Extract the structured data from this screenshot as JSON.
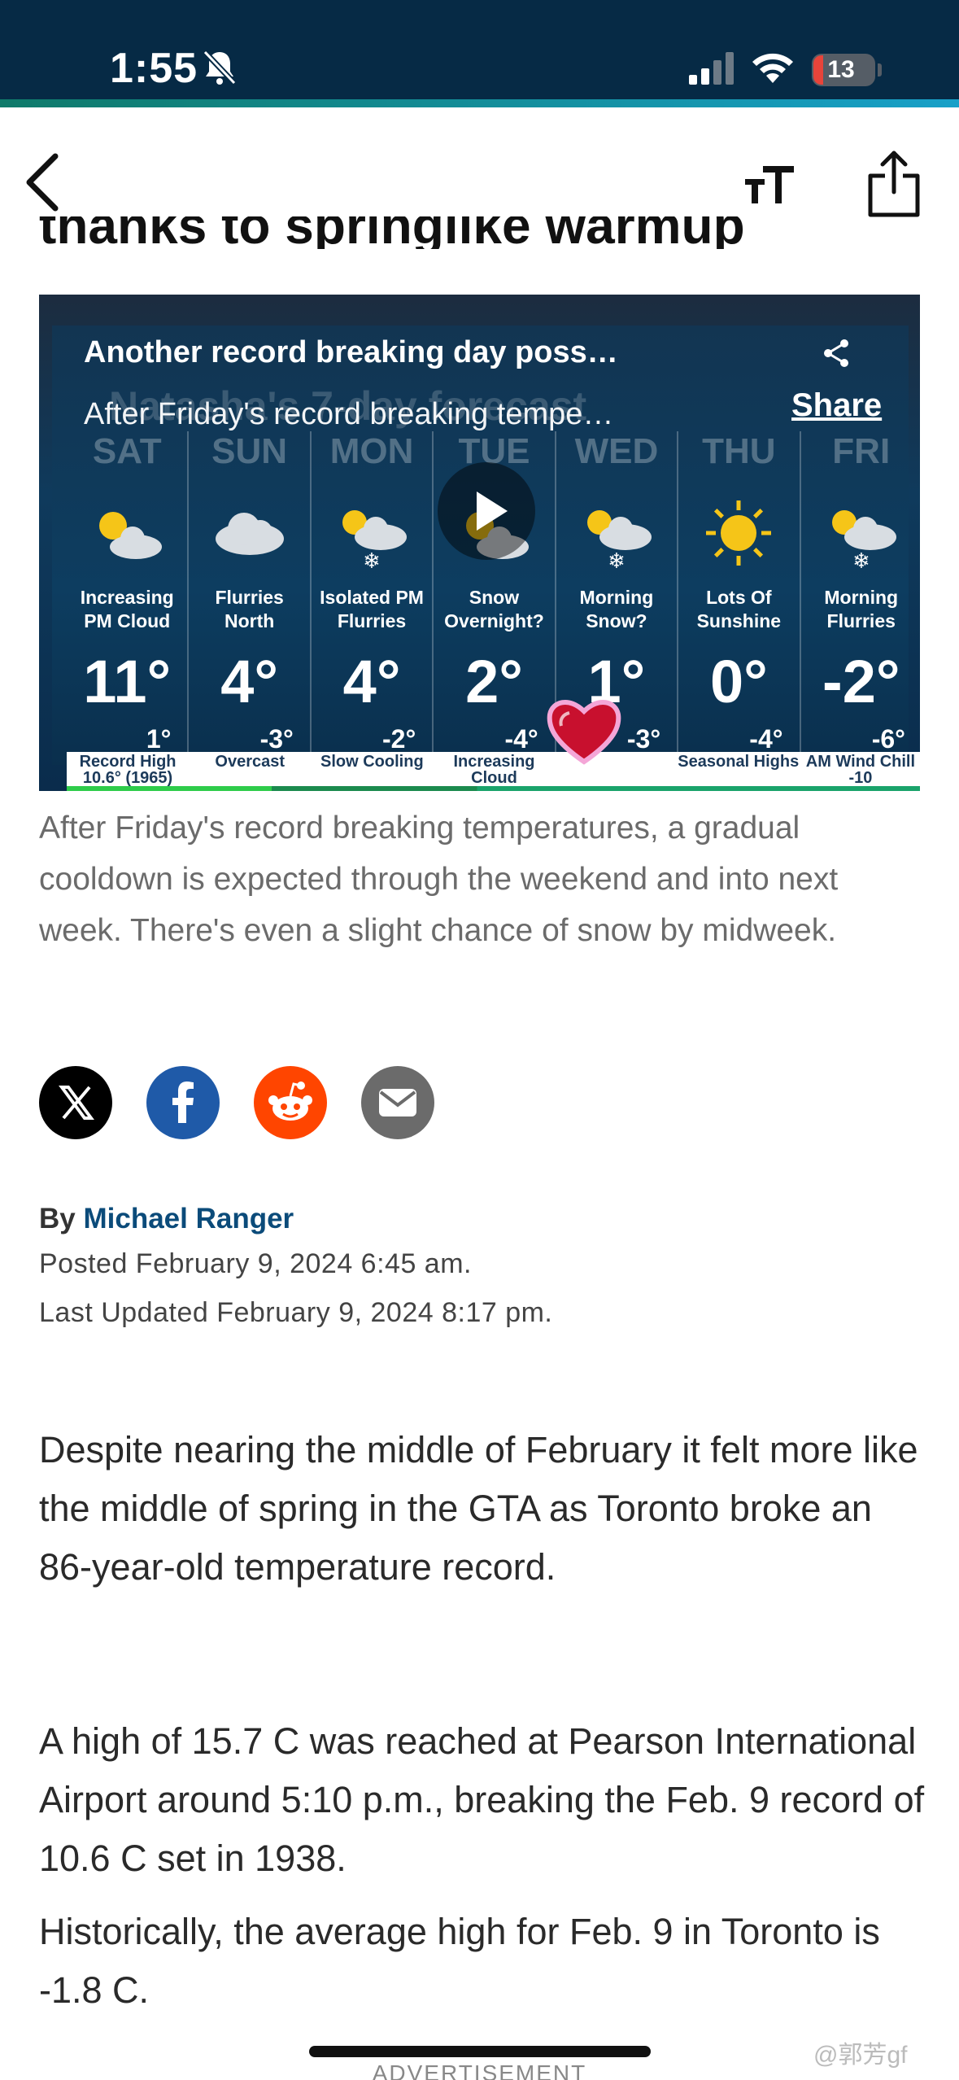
{
  "status": {
    "time": "1:55",
    "battery": "13"
  },
  "article": {
    "partial_title": "thanks to springlike warmup"
  },
  "video": {
    "title": "Another record breaking day poss…",
    "subtitle": "After Friday's record breaking tempe…",
    "share_label": "Share",
    "background_title": "Natasha's 7-day forecast",
    "days": [
      {
        "name": "SAT",
        "condition": "Increasing PM Cloud",
        "high": "11°",
        "low": "1°",
        "footer": "Record High 10.6° (1965)",
        "icon": "sun-cloud-icon"
      },
      {
        "name": "SUN",
        "condition": "Flurries North",
        "high": "4°",
        "low": "-3°",
        "footer": "Overcast",
        "icon": "cloud-icon"
      },
      {
        "name": "MON",
        "condition": "Isolated PM Flurries",
        "high": "4°",
        "low": "-2°",
        "footer": "Slow Cooling",
        "icon": "sun-snow-icon"
      },
      {
        "name": "TUE",
        "condition": "Snow Overnight?",
        "high": "2°",
        "low": "-4°",
        "footer": "Increasing Cloud",
        "icon": "sun-cloud-icon"
      },
      {
        "name": "WED",
        "condition": "Morning Snow?",
        "high": "1°",
        "low": "-3°",
        "footer": "",
        "icon": "sun-snow-icon"
      },
      {
        "name": "THU",
        "condition": "Lots Of Sunshine",
        "high": "0°",
        "low": "-4°",
        "footer": "Seasonal Highs",
        "icon": "sun-icon"
      },
      {
        "name": "FRI",
        "condition": "Morning Flurries",
        "high": "-2°",
        "low": "-6°",
        "footer": "AM Wind Chill -10",
        "icon": "sun-snow-icon"
      }
    ]
  },
  "caption": "After Friday's record breaking temperatures, a gradual cooldown is expected through the weekend and into next week. There's even a slight chance of snow by midweek.",
  "byline": {
    "prefix": "By",
    "author": "Michael Ranger",
    "posted": "Posted February 9, 2024 6:45 am.",
    "updated": "Last Updated February 9, 2024 8:17 pm."
  },
  "paragraphs": [
    "Despite nearing the middle of February it felt more like the middle of spring in the GTA as Toronto broke an 86-year-old temperature record.",
    "A high of 15.7 C was reached at Pearson International Airport around 5:10 p.m., breaking the Feb. 9 record of 10.6 C set in 1938.",
    "Historically, the average high for Feb. 9 in Toronto is -1.8 C."
  ],
  "advertisement_label": "ADVERTISEMENT",
  "watermark": "@郭芳gf",
  "colors": {
    "status_bar": "#062a45",
    "author_link": "#0b4b7a",
    "facebook": "#1f5aa8",
    "reddit": "#ff4500",
    "email": "#6b6b6b",
    "x": "#000000"
  }
}
